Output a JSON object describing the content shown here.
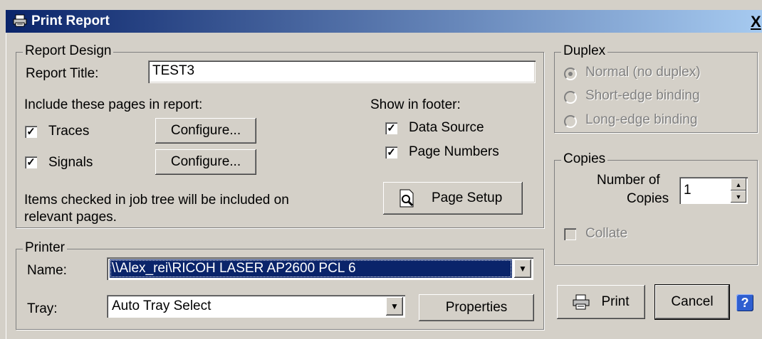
{
  "window": {
    "title": "Print Report",
    "close_label": "X"
  },
  "report_design": {
    "legend": "Report Design",
    "title_label": "Report Title:",
    "title_value": "TEST3",
    "include_label": "Include these pages in report:",
    "traces": {
      "label": "Traces",
      "checked": true,
      "button": "Configure..."
    },
    "signals": {
      "label": "Signals",
      "checked": true,
      "button": "Configure..."
    },
    "footer_label": "Show in footer:",
    "data_source": {
      "label": "Data Source",
      "checked": true
    },
    "page_numbers": {
      "label": "Page Numbers",
      "checked": true
    },
    "page_setup_button": "Page Setup",
    "note_line1": "Items checked in job tree will be included on",
    "note_line2": "relevant pages."
  },
  "printer": {
    "legend": "Printer",
    "name_label": "Name:",
    "name_value": "\\\\Alex_rei\\RICOH LASER AP2600 PCL 6",
    "tray_label": "Tray:",
    "tray_value": "Auto Tray Select",
    "properties_button": "Properties"
  },
  "duplex": {
    "legend": "Duplex",
    "options": [
      "Normal (no duplex)",
      "Short-edge binding",
      "Long-edge binding"
    ],
    "selected": "Normal (no duplex)"
  },
  "copies": {
    "legend": "Copies",
    "number_label_line1": "Number of",
    "number_label_line2": "Copies",
    "number_value": "1",
    "collate_label": "Collate",
    "collate_checked": false
  },
  "actions": {
    "print": "Print",
    "cancel": "Cancel",
    "help": "?"
  }
}
